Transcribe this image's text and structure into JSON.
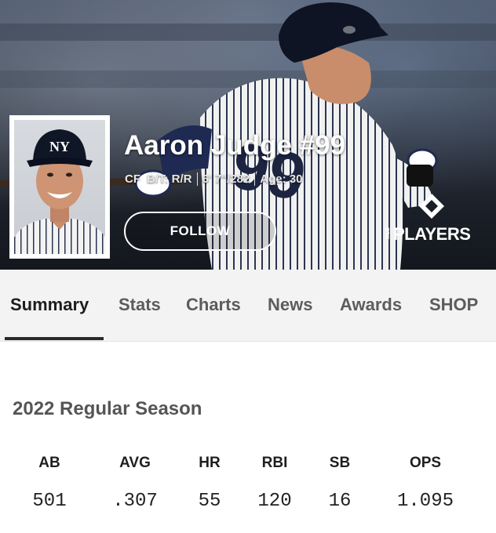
{
  "player": {
    "name": "Aaron Judge #99",
    "position": "CF",
    "bats_throws": "B/T: R/R",
    "height_weight": "6' 7\"/282",
    "age": "Age: 30",
    "cap_logo": "NY"
  },
  "actions": {
    "follow_label": "FOLLOW"
  },
  "brand": {
    "logo_small": "MLB",
    "logo_text": "PLAYERS"
  },
  "tabs": [
    {
      "label": "Summary",
      "active": true
    },
    {
      "label": "Stats",
      "active": false
    },
    {
      "label": "Charts",
      "active": false
    },
    {
      "label": "News",
      "active": false
    },
    {
      "label": "Awards",
      "active": false
    },
    {
      "label": "SHOP",
      "active": false
    }
  ],
  "season": {
    "title": "2022 Regular Season",
    "stats": [
      {
        "label": "AB",
        "value": "501"
      },
      {
        "label": "AVG",
        "value": ".307"
      },
      {
        "label": "HR",
        "value": "55"
      },
      {
        "label": "RBI",
        "value": "120"
      },
      {
        "label": "SB",
        "value": "16"
      },
      {
        "label": "OPS",
        "value": "1.095"
      }
    ]
  },
  "colors": {
    "hero_dark": "#1a1e26",
    "tab_bar": "#f3f3f3",
    "active_tab": "#1d1d1d",
    "inactive_tab": "#5c5c5c"
  }
}
